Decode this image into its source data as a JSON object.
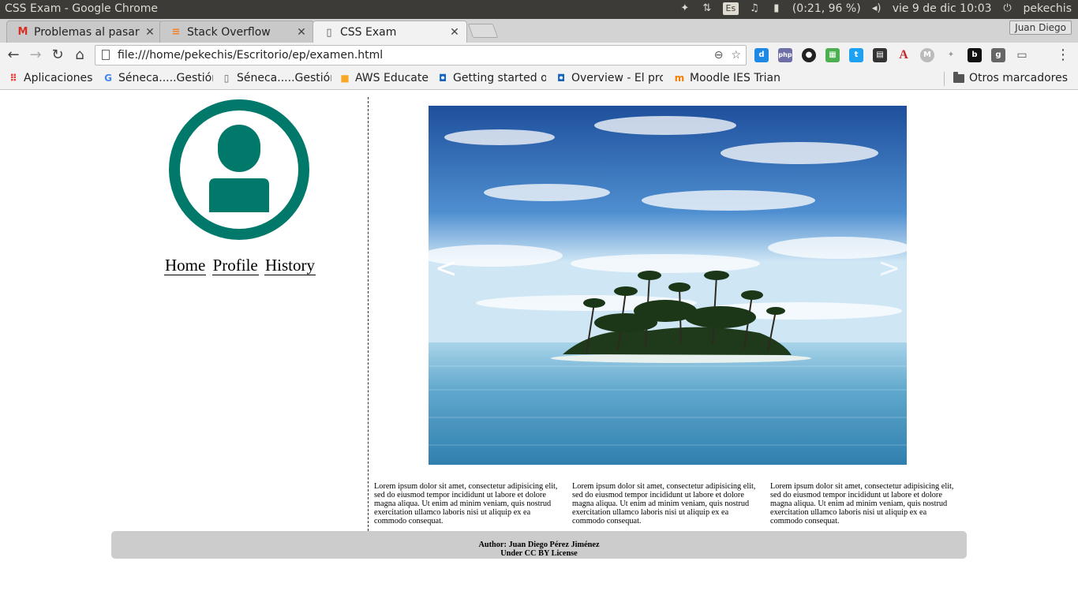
{
  "os": {
    "window_title": "CSS Exam - Google Chrome",
    "keyboard_layout": "Es",
    "battery": "(0:21, 96 %)",
    "datetime": "vie 9 de dic 10:03",
    "user": "pekechis"
  },
  "tabs": [
    {
      "label": "Problemas al pasar",
      "icon": "gmail-icon"
    },
    {
      "label": "Stack Overflow",
      "icon": "stackoverflow-icon"
    },
    {
      "label": "CSS Exam",
      "icon": "page-icon",
      "active": true
    }
  ],
  "profile": {
    "name": "Juan Diego"
  },
  "address_bar": {
    "url": "file:///home/pekechis/Escritorio/ep/examen.html"
  },
  "bookmarks": {
    "apps_label": "Aplicaciones",
    "items": [
      {
        "label": "Séneca.....Gestión"
      },
      {
        "label": "Séneca.....Gestión"
      },
      {
        "label": "AWS Educate"
      },
      {
        "label": "Getting started o"
      },
      {
        "label": "Overview - El pro"
      },
      {
        "label": "Moodle IES Triana"
      }
    ],
    "other_label": "Otros marcadores"
  },
  "page": {
    "nav": [
      "Home",
      "Profile",
      "History"
    ],
    "slider": {
      "prev": "<",
      "next": ">"
    },
    "articles": [
      "Lorem ipsum dolor sit amet, consectetur adipisicing elit, sed do eiusmod tempor incididunt ut labore et dolore magna aliqua. Ut enim ad minim veniam, quis nostrud exercitation ullamco laboris nisi ut aliquip ex ea commodo consequat.",
      "Lorem ipsum dolor sit amet, consectetur adipisicing elit, sed do eiusmod tempor incididunt ut labore et dolore magna aliqua. Ut enim ad minim veniam, quis nostrud exercitation ullamco laboris nisi ut aliquip ex ea commodo consequat.",
      "Lorem ipsum dolor sit amet, consectetur adipisicing elit, sed do eiusmod tempor incididunt ut labore et dolore magna aliqua. Ut enim ad minim veniam, quis nostrud exercitation ullamco laboris nisi ut aliquip ex ea commodo consequat."
    ],
    "footer": {
      "author": "Author: Juan Diego Pérez Jiménez",
      "license": "Under CC BY License"
    }
  },
  "colors": {
    "avatar": "#00796b",
    "footer_bg": "#cccccc",
    "os_bar": "#3c3b37"
  }
}
